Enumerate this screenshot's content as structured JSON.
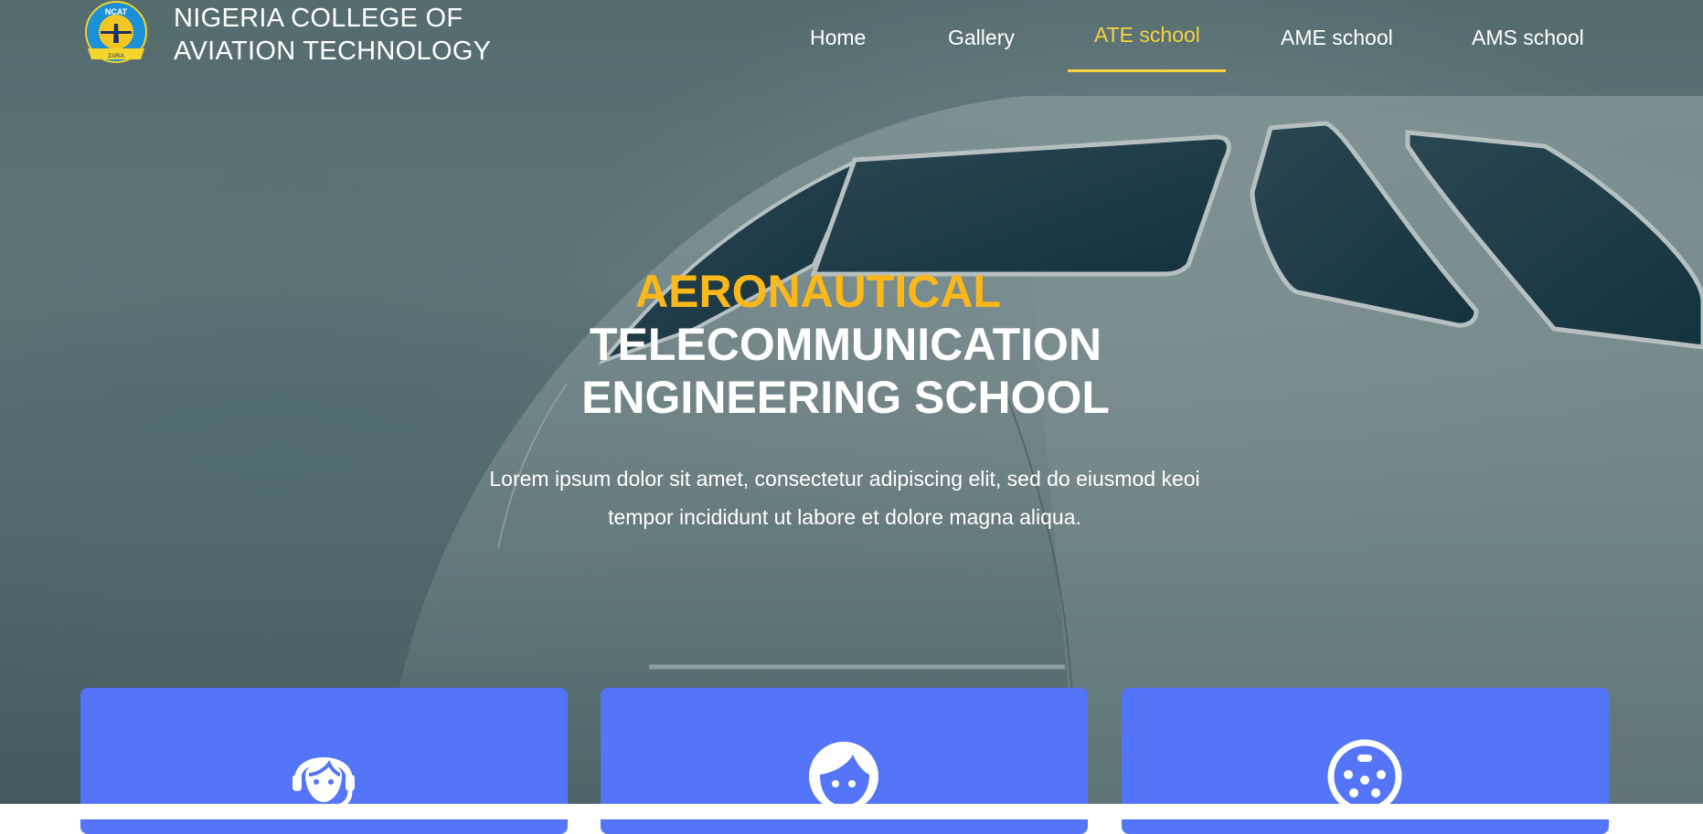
{
  "header": {
    "logo_text": "NCAT",
    "logo_ribbon": "ZARIA",
    "brand_line1": "NIGERIA COLLEGE OF",
    "brand_line2": "AVIATION TECHNOLOGY"
  },
  "nav": {
    "items": [
      {
        "label": "Home"
      },
      {
        "label": "Gallery"
      },
      {
        "label": "ATE school",
        "active": true
      },
      {
        "label": "AME school"
      },
      {
        "label": "AMS school"
      }
    ]
  },
  "hero": {
    "title_accent": "AERONAUTICAL",
    "title_line2": "TELECOMMUNICATION",
    "title_line3": "ENGINEERING SCHOOL",
    "description": "Lorem ipsum dolor sit amet, consectetur adipiscing elit, sed do eiusmod keoi tempor incididunt ut labore et dolore magna aliqua."
  },
  "cards": [
    {
      "icon": "headset-agent-icon"
    },
    {
      "icon": "face-icon"
    },
    {
      "icon": "connector-icon"
    }
  ],
  "colors": {
    "accent_yellow": "#f7d23e",
    "title_accent": "#fbb81b",
    "card_blue": "#5475f7"
  }
}
